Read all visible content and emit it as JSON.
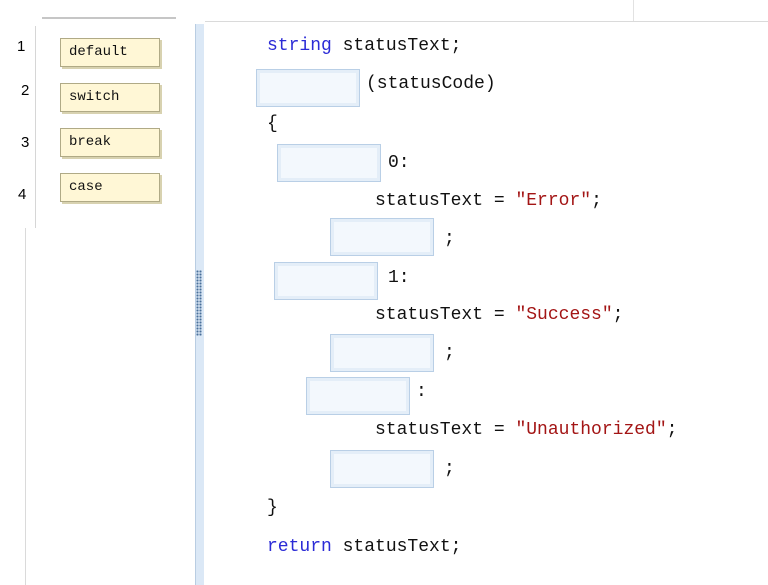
{
  "answer_choices": [
    {
      "number": "1",
      "label": "default"
    },
    {
      "number": "2",
      "label": "switch"
    },
    {
      "number": "3",
      "label": "break"
    },
    {
      "number": "4",
      "label": "case"
    }
  ],
  "code": {
    "line1_type": "string",
    "line1_rest": " statusText;",
    "line2_rest": "(statusCode)",
    "open_brace": "{",
    "case0_suffix": "0:",
    "assign_prefix": "statusText = ",
    "str_error": "\"Error\"",
    "str_success": "\"Success\"",
    "str_unauthorized": "\"Unauthorized\"",
    "semicolon": ";",
    "case1_suffix": "1:",
    "default_suffix": ":",
    "close_brace": "}",
    "return_kw": "return",
    "return_rest": " statusText;"
  }
}
